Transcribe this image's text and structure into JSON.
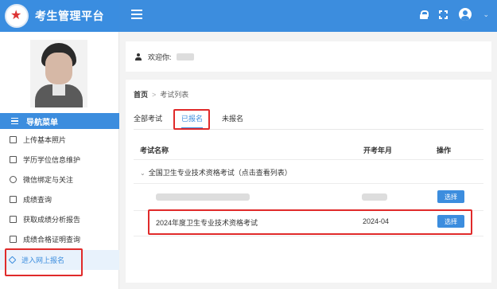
{
  "app": {
    "title": "考生管理平台"
  },
  "sidebar": {
    "nav_title": "导航菜单",
    "items": [
      {
        "label": "上传基本照片",
        "icon": "image-icon"
      },
      {
        "label": "学历学位信息维护",
        "icon": "book-icon"
      },
      {
        "label": "微信绑定与关注",
        "icon": "wechat-icon"
      },
      {
        "label": "成绩查询",
        "icon": "document-icon"
      },
      {
        "label": "获取成绩分析报告",
        "icon": "report-icon"
      },
      {
        "label": "成绩合格证明查询",
        "icon": "certificate-icon"
      },
      {
        "label": "进入网上报名",
        "icon": "send-icon",
        "active": true
      }
    ]
  },
  "header": {
    "icons": [
      "lock-icon",
      "fullscreen-icon",
      "user-avatar-icon",
      "chevron-down-icon"
    ]
  },
  "welcome": {
    "label": "欢迎你:"
  },
  "breadcrumb": {
    "home": "首页",
    "current": "考试列表"
  },
  "tabs": [
    {
      "label": "全部考试",
      "active": false
    },
    {
      "label": "已报名",
      "active": true
    },
    {
      "label": "未报名",
      "active": false
    }
  ],
  "table": {
    "headers": {
      "name": "考试名称",
      "date": "开考年月",
      "action": "操作"
    },
    "group_label": "全国卫生专业技术资格考试（点击查看列表）",
    "rows": [
      {
        "name": "",
        "date": "",
        "action": "选择"
      },
      {
        "name": "2024年度卫生专业技术资格考试",
        "date": "2024-04",
        "action": "选择"
      }
    ]
  },
  "colors": {
    "primary": "#3c8dde",
    "highlight": "#e02a2a"
  }
}
